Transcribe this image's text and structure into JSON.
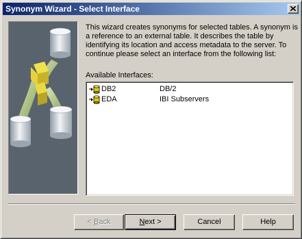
{
  "window": {
    "title": "Synonym Wizard - Select Interface"
  },
  "main": {
    "description": "This wizard creates synonyms for selected tables.  A synonym is a reference to an external  table. It describes the table by identifying its location and access metadata to the server. To continue please select an interface from the following list:",
    "list_label": "Available Interfaces:",
    "interfaces": [
      {
        "name": "DB2",
        "description": "DB/2",
        "icon": "database-icon"
      },
      {
        "name": "EDA",
        "description": "IBI Subservers",
        "icon": "database-icon"
      }
    ]
  },
  "buttons": {
    "back": {
      "pre": "< ",
      "key": "B",
      "post": "ack",
      "enabled": false
    },
    "next": {
      "pre": "",
      "key": "N",
      "post": "ext >",
      "enabled": true
    },
    "cancel": {
      "label": "Cancel"
    },
    "help": {
      "label": "Help"
    }
  },
  "colors": {
    "titlebar_start": "#0a246a",
    "titlebar_end": "#a6caf0",
    "face": "#d4d0c8",
    "image_bg": "#59636d"
  }
}
